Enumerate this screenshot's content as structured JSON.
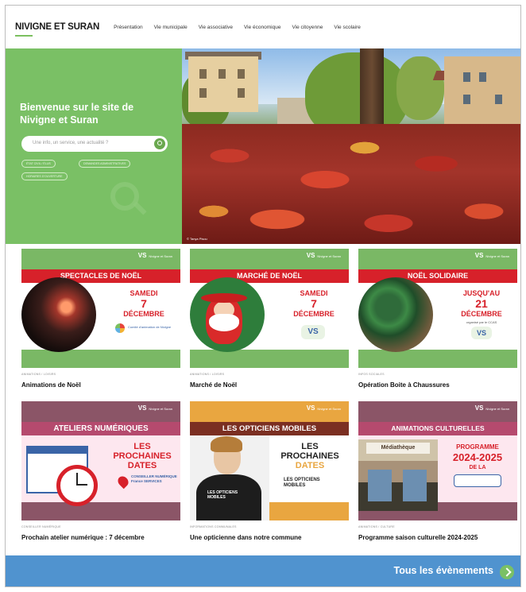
{
  "nav": {
    "logo": "NIVIGNE ET SURAN",
    "items": [
      "Présentation",
      "Vie municipale",
      "Vie associative",
      "Vie économique",
      "Vie citoyenne",
      "Vie scolaire"
    ]
  },
  "hero": {
    "title": "Bienvenue sur le site de Nivigne et Suran",
    "search_placeholder": "Une info, un service, une actualité ?",
    "chips": [
      "ÉTAT CIVIL / ÉLUS",
      "DEMANDES ADMINISTRATIVES",
      "HORAIRES D'OUVERTURE"
    ],
    "photo_credit": "© Tanya Pisou"
  },
  "cards": [
    {
      "category": "ANIMATIONS / LOISIRS",
      "title": "Animations de Noël",
      "banner": "SPECTACLES DE NOËL",
      "line1": "SAMEDI",
      "line2": "7",
      "line3": "DÉCEMBRE",
      "logo_text": "Nivigne et Suran",
      "sub": "Comité d'animation de Nivigne"
    },
    {
      "category": "ANIMATIONS / LOISIRS",
      "title": "Marché de Noël",
      "banner": "MARCHÉ DE NOËL",
      "line1": "SAMEDI",
      "line2": "7",
      "line3": "DÉCEMBRE",
      "logo_text": "Nivigne et Suran"
    },
    {
      "category": "INFOS SOCIALES",
      "title": "Opération Boite à Chaussures",
      "banner": "NOËL SOLIDAIRE",
      "line1": "JUSQU'AU",
      "line2": "21",
      "line3": "DÉCEMBRE",
      "sub": "organisé par le CCAS",
      "logo_text": "Nivigne et Suran"
    },
    {
      "category": "CONSEILLER NUMÉRIQUE",
      "title": "Prochain atelier numérique : 7 décembre",
      "banner": "ATELIERS NUMÉRIQUES",
      "line1": "LES",
      "line2": "PROCHAINES",
      "line3": "DATES",
      "sub": "CONSEILLER NUMÉRIQUE France SERVICES",
      "logo_text": "Nivigne et Suran"
    },
    {
      "category": "INFORMATIONS COMMUNALES",
      "title": "Une opticienne dans notre commune",
      "banner": "LES OPTICIENS MOBILES",
      "line1": "LES",
      "line2": "PROCHAINES",
      "line3": "DATES",
      "sub": "LES OPTICIENS MOBILES",
      "shirt": "LES OPTICIENS MOBILES",
      "logo_text": "Nivigne et Suran"
    },
    {
      "category": "ANIMATIONS / CULTURE",
      "title": "Programme saison culturelle 2024-2025",
      "banner": "ANIMATIONS CULTURELLES",
      "line1": "PROGRAMME",
      "line2": "2024-2025",
      "line3": "DE LA",
      "sub": "Médiathèque",
      "logo_text": "Nivigne et Suran"
    }
  ],
  "footer": {
    "label": "Tous les évènements"
  }
}
